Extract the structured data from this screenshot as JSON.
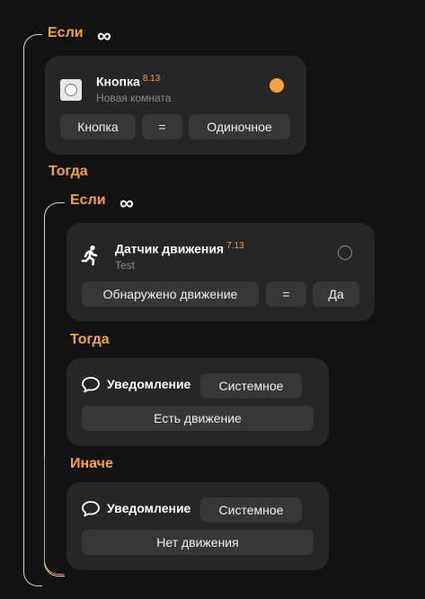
{
  "colors": {
    "accent": "#f5a238",
    "card": "#262626",
    "pill": "#373737",
    "bg": "#121212"
  },
  "outer": {
    "if_label": "Если",
    "loop_icon": "infinity-icon",
    "trigger": {
      "icon": "button-device-icon",
      "title": "Кнопка",
      "version": "8.13",
      "room": "Новая комната",
      "status_color": "#f5a238",
      "cond_field": "Кнопка",
      "cond_op": "=",
      "cond_value": "Одиночное"
    },
    "then_label": "Тогда"
  },
  "inner": {
    "if_label": "Если",
    "loop_icon": "infinity-icon",
    "trigger": {
      "icon": "running-person-icon",
      "title": "Датчик движения",
      "version": "7.13",
      "room": "Test",
      "cond_field": "Обнаружено движение",
      "cond_op": "=",
      "cond_value": "Да"
    },
    "then_label": "Тогда",
    "then_action": {
      "icon": "chat-bubble-icon",
      "title": "Уведомление",
      "type": "Системное",
      "message": "Есть движение"
    },
    "else_label": "Иначе",
    "else_action": {
      "icon": "chat-bubble-icon",
      "title": "Уведомление",
      "type": "Системное",
      "message": "Нет движения"
    }
  }
}
